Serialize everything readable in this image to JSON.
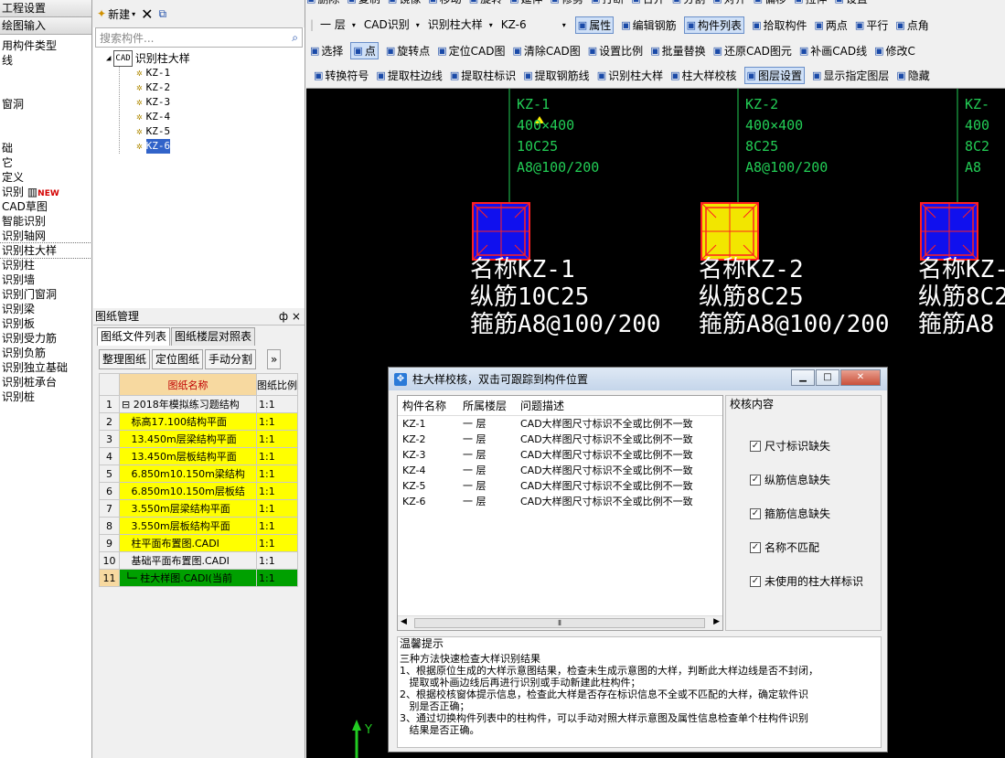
{
  "nav": {
    "headers": [
      "工程设置",
      "绘图输入"
    ],
    "items": [
      "用构件类型",
      "线",
      "",
      "",
      "窗洞",
      "",
      "",
      "础",
      "它",
      "定义",
      "识别",
      "CAD草图",
      "智能识别",
      "识别轴网",
      "识别柱大样",
      "识别柱",
      "识别墙",
      "识别门窗洞",
      "识别梁",
      "识别板",
      "识别受力筋",
      "识别负筋",
      "识别独立基础",
      "识别桩承台",
      "识别桩"
    ],
    "new_badge": "NEW",
    "selected_index": 14
  },
  "tree": {
    "new_label": "新建",
    "search_placeholder": "搜索构件...",
    "root": "识别柱大样",
    "nodes": [
      "KZ-1",
      "KZ-2",
      "KZ-3",
      "KZ-4",
      "KZ-5",
      "KZ-6"
    ],
    "selected": 5
  },
  "drawings": {
    "panel_title": "图纸管理",
    "pin": "ф ×",
    "tabs": [
      "图纸文件列表",
      "图纸楼层对照表"
    ],
    "buttons": [
      "整理图纸",
      "定位图纸",
      "手动分割"
    ],
    "more": "»",
    "col_name": "图纸名称",
    "col_ratio": "图纸比例",
    "rows": [
      {
        "n": "1",
        "name": "⊟ 2018年模拟练习题结构",
        "ratio": "1:1",
        "style": "plain"
      },
      {
        "n": "2",
        "name": "   标高17.100结构平面",
        "ratio": "1:1",
        "style": "yel"
      },
      {
        "n": "3",
        "name": "   13.450m层梁结构平面",
        "ratio": "1:1",
        "style": "yel"
      },
      {
        "n": "4",
        "name": "   13.450m层板结构平面",
        "ratio": "1:1",
        "style": "yel"
      },
      {
        "n": "5",
        "name": "   6.850m10.150m梁结构",
        "ratio": "1:1",
        "style": "yel"
      },
      {
        "n": "6",
        "name": "   6.850m10.150m层板结",
        "ratio": "1:1",
        "style": "yel"
      },
      {
        "n": "7",
        "name": "   3.550m层梁结构平面",
        "ratio": "1:1",
        "style": "yel"
      },
      {
        "n": "8",
        "name": "   3.550m层板结构平面",
        "ratio": "1:1",
        "style": "yel"
      },
      {
        "n": "9",
        "name": "   柱平面布置图.CADI",
        "ratio": "1:1",
        "style": "yel"
      },
      {
        "n": "10",
        "name": "   基础平面布置图.CADI",
        "ratio": "1:1",
        "style": "plain"
      },
      {
        "n": "11",
        "name": " └─ 柱大样图.CADI(当前",
        "ratio": "1:1",
        "style": "grn"
      }
    ]
  },
  "toolbar": {
    "row0": [
      "删除",
      "复制",
      "镜像",
      "移动",
      "旋转",
      "延伸",
      "修剪",
      "打断",
      "合并",
      "分割",
      "对齐",
      "偏移",
      "拉伸",
      "设置"
    ],
    "floor": "一 层",
    "cad_recog": "CAD识别",
    "recog_col": "识别柱大样",
    "kz": "KZ-6",
    "row1": [
      "属性",
      "编辑钢筋",
      "构件列表",
      "拾取构件",
      "两点",
      "平行",
      "点角"
    ],
    "row2": [
      "选择",
      "点",
      "旋转点",
      "定位CAD图",
      "清除CAD图",
      "设置比例",
      "批量替换",
      "还原CAD图元",
      "补画CAD线",
      "修改C"
    ],
    "row3": [
      "转换符号",
      "提取柱边线",
      "提取柱标识",
      "提取钢筋线",
      "识别柱大样",
      "柱大样校核",
      "图层设置",
      "显示指定图层",
      "隐藏"
    ]
  },
  "cad": {
    "cols": [
      {
        "name": "KZ-1",
        "size": "400×400",
        "main": "10C25",
        "stir": "A8@100/200",
        "big1": "名称KZ-1",
        "big2": "纵筋10C25",
        "big3": "箍筋A8@100/200",
        "fill": "#1010ee"
      },
      {
        "name": "KZ-2",
        "size": "400×400",
        "main": "8C25",
        "stir": "A8@100/200",
        "big1": "名称KZ-2",
        "big2": "纵筋8C25",
        "big3": "箍筋A8@100/200",
        "fill": "#f2e600"
      },
      {
        "name": "KZ-",
        "size": "400",
        "main": "8C2",
        "stir": "A8",
        "big1": "名称KZ-",
        "big2": "纵筋8C2",
        "big3": "箍筋A8",
        "fill": "#1010ee"
      }
    ],
    "axis_label": "Y"
  },
  "dialog": {
    "title": "柱大样校核，双击可跟踪到构件位置",
    "headers": [
      "构件名称",
      "所属楼层",
      "问题描述"
    ],
    "rows": [
      {
        "name": "KZ-1",
        "floor": "一 层",
        "desc": "CAD大样图尺寸标识不全或比例不一致"
      },
      {
        "name": "KZ-2",
        "floor": "一 层",
        "desc": "CAD大样图尺寸标识不全或比例不一致"
      },
      {
        "name": "KZ-3",
        "floor": "一 层",
        "desc": "CAD大样图尺寸标识不全或比例不一致"
      },
      {
        "name": "KZ-4",
        "floor": "一 层",
        "desc": "CAD大样图尺寸标识不全或比例不一致"
      },
      {
        "name": "KZ-5",
        "floor": "一 层",
        "desc": "CAD大样图尺寸标识不全或比例不一致"
      },
      {
        "name": "KZ-6",
        "floor": "一 层",
        "desc": "CAD大样图尺寸标识不全或比例不一致"
      }
    ],
    "check_title": "校核内容",
    "checks": [
      "尺寸标识缺失",
      "纵筋信息缺失",
      "箍筋信息缺失",
      "名称不匹配",
      "未使用的柱大样标识"
    ],
    "tips_title": "温馨提示",
    "tips": [
      "三种方法快速检查大样识别结果",
      "1、根据原位生成的大样示意图结果，检查未生成示意图的大样，判断此大样边线是否不封闭，",
      "   提取或补画边线后再进行识别或手动新建此柱构件；",
      "2、根据校核窗体提示信息，检查此大样是否存在标识信息不全或不匹配的大样，确定软件识",
      "   别是否正确；",
      "3、通过切换构件列表中的柱构件，可以手动对照大样示意图及属性信息检查单个柱构件识别",
      "   结果是否正确。"
    ]
  }
}
